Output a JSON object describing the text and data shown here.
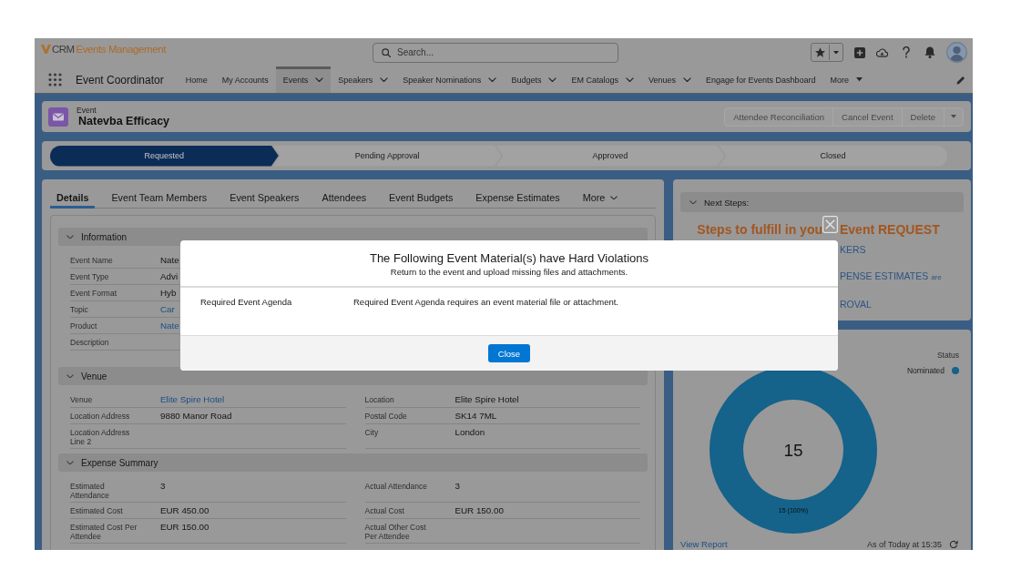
{
  "header": {
    "logo": {
      "prefix": "CRM",
      "name": "Events Management"
    },
    "search": {
      "placeholder": "Search..."
    }
  },
  "nav": {
    "app_name": "Event Coordinator",
    "items": [
      {
        "label": "Home",
        "kind": "link",
        "selected": false
      },
      {
        "label": "My Accounts",
        "kind": "link",
        "selected": false
      },
      {
        "label": "Events",
        "kind": "menu",
        "selected": true
      },
      {
        "label": "Speakers",
        "kind": "menu",
        "selected": false
      },
      {
        "label": "Speaker Nominations",
        "kind": "menu",
        "selected": false
      },
      {
        "label": "Budgets",
        "kind": "menu",
        "selected": false
      },
      {
        "label": "EM Catalogs",
        "kind": "menu",
        "selected": false
      },
      {
        "label": "Venues",
        "kind": "menu",
        "selected": false
      },
      {
        "label": "Engage for Events Dashboard",
        "kind": "link",
        "selected": false
      },
      {
        "label": "More",
        "kind": "more",
        "selected": false
      }
    ]
  },
  "record": {
    "type_label": "Event",
    "title": "Natevba Efficacy",
    "actions": [
      {
        "label": "Attendee Reconciliation",
        "disabled": true
      },
      {
        "label": "Cancel Event",
        "disabled": true
      },
      {
        "label": "Delete",
        "disabled": true
      }
    ]
  },
  "path": {
    "stages": [
      {
        "label": "Requested",
        "selected": true
      },
      {
        "label": "Pending Approval",
        "selected": false
      },
      {
        "label": "Approved",
        "selected": false
      },
      {
        "label": "Closed",
        "selected": false
      }
    ]
  },
  "details": {
    "tabs": [
      {
        "label": "Details",
        "kind": "tab",
        "selected": true
      },
      {
        "label": "Event Team Members",
        "kind": "tab",
        "selected": false
      },
      {
        "label": "Event Speakers",
        "kind": "tab",
        "selected": false
      },
      {
        "label": "Attendees",
        "kind": "tab",
        "selected": false
      },
      {
        "label": "Event Budgets",
        "kind": "tab",
        "selected": false
      },
      {
        "label": "Expense Estimates",
        "kind": "tab",
        "selected": false
      },
      {
        "label": "More",
        "kind": "more",
        "selected": false
      }
    ],
    "sections": [
      {
        "title": "Information",
        "expanded": true,
        "rows": [
          [
            {
              "label": "Event Name",
              "value": "Nate",
              "kind": "text"
            }
          ],
          [
            {
              "label": "Event Type",
              "value": "Advi",
              "kind": "text"
            }
          ],
          [
            {
              "label": "Event Format",
              "value": "Hyb",
              "kind": "text"
            }
          ],
          [
            {
              "label": "Topic",
              "value": "Car",
              "kind": "link"
            }
          ],
          [
            {
              "label": "Product",
              "value": "Nate",
              "kind": "link"
            }
          ],
          [
            {
              "label": "Description"
            }
          ]
        ]
      },
      {
        "title": "Venue",
        "expanded": true,
        "rows": [
          [
            {
              "label": "Venue",
              "value": "Elite Spire Hotel",
              "kind": "link"
            },
            {
              "label": "Location",
              "value": "Elite Spire Hotel",
              "kind": "text"
            }
          ],
          [
            {
              "label": "Location Address",
              "value": "9880 Manor Road",
              "kind": "text"
            },
            {
              "label": "Postal Code",
              "value": "SK14 7ML",
              "kind": "text"
            }
          ],
          [
            {
              "label": "Location Address Line 2"
            },
            {
              "label": "City",
              "value": "London",
              "kind": "text"
            }
          ]
        ]
      },
      {
        "title": "Expense Summary",
        "expanded": true,
        "rows": [
          [
            {
              "label": "Estimated Attendance",
              "value": "3",
              "kind": "text"
            },
            {
              "label": "Actual Attendance",
              "value": "3",
              "kind": "text"
            }
          ],
          [
            {
              "label": "Estimated Cost",
              "value": "EUR 450.00",
              "kind": "text"
            },
            {
              "label": "Actual Cost",
              "value": "EUR 150.00",
              "kind": "text"
            }
          ],
          [
            {
              "label": "Estimated Cost Per Attendee",
              "value": "EUR 150.00",
              "kind": "text"
            },
            {
              "label": "Actual Other Cost Per Attendee"
            }
          ]
        ]
      }
    ]
  },
  "next_steps": {
    "title": "Next Steps:",
    "expanded": true,
    "heading_start": "Steps to fulfill in you",
    "heading_end": "Event REQUEST",
    "items": [
      {
        "text": "KERS"
      },
      {
        "text": "PENSE ESTIMATES",
        "note": "are"
      },
      {
        "text": "ROVAL"
      }
    ]
  },
  "chart": {
    "legend_title": "Status",
    "legend": [
      {
        "label": "Nominated",
        "color": "#15628a"
      }
    ],
    "center_label": "15",
    "slice_label": "15 (100%)",
    "footer": {
      "link": "View Report",
      "timestamp": "As of Today at 15:35"
    }
  },
  "modal": {
    "title": "The Following Event Material(s) have Hard Violations",
    "subtitle": "Return to the event and upload missing files and attachments.",
    "violations": [
      {
        "material": "Required Event Agenda",
        "message": "Required Event Agenda requires an event material file or attachment."
      }
    ],
    "close_label": "Close"
  }
}
